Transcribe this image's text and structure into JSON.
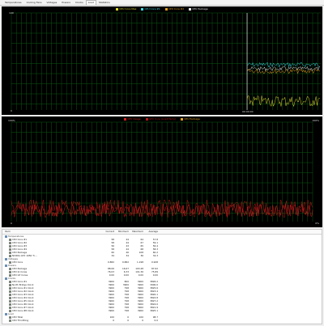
{
  "tabs": [
    "Temperatures",
    "Cooling Fans",
    "Voltages",
    "Powers",
    "Clocks",
    "Load",
    "Statistics"
  ],
  "active_tab": 5,
  "colors": {
    "yellow": "#d8d830",
    "cyan": "#38d8e0",
    "orange": "#e0a020",
    "white": "#e8e8e8",
    "red": "#d02020",
    "darkred": "#b01818",
    "grid": "#0b5a12"
  },
  "chart_top": {
    "legend": [
      {
        "label": "CPU Core Max",
        "color": "#d8d830"
      },
      {
        "label": "CPU Core #1",
        "color": "#38d8e0"
      },
      {
        "label": "CPU Core #2",
        "color": "#e0a020"
      },
      {
        "label": "CPU Package",
        "color": "#e8e8e8"
      }
    ],
    "y_top": "100",
    "y_bottom": "0",
    "x_label": "00:00:00"
  },
  "chart_bottom": {
    "legend": [
      {
        "label": "CPU Usage",
        "color": "#d02020"
      },
      {
        "label": "GPU Core (Load/Temp)",
        "color": "#b01818"
      },
      {
        "label": "CPU Package",
        "color": "#e0a020"
      }
    ],
    "y_top": "100%",
    "y_bottom": "0",
    "y_top_right": "100%",
    "y_bottom_right": "0%"
  },
  "table": {
    "headers": [
      "Item",
      "Current",
      "Minimum",
      "Maximum",
      "Average"
    ],
    "rows": [
      {
        "name": "Temperatures",
        "group": true,
        "cb": false,
        "vals": [
          "",
          "",
          "",
          ""
        ]
      },
      {
        "name": "CPU Core #1",
        "group": false,
        "cb": true,
        "vals": [
          "58",
          "44",
          "64",
          "57.8"
        ]
      },
      {
        "name": "CPU Core #2",
        "group": false,
        "cb": true,
        "vals": [
          "58",
          "44",
          "67",
          "59.1"
        ]
      },
      {
        "name": "CPU Core #3",
        "group": false,
        "cb": true,
        "vals": [
          "56",
          "43",
          "65",
          "56.4"
        ]
      },
      {
        "name": "CPU Core #4",
        "group": false,
        "cb": true,
        "vals": [
          "58",
          "44",
          "68",
          "58.3"
        ]
      },
      {
        "name": "CPU Package",
        "group": false,
        "cb": true,
        "vals": [
          "60",
          "46",
          "108",
          "60.2"
        ]
      },
      {
        "name": "NVIDIA GTX 1050 Ti ...",
        "group": false,
        "cb": true,
        "vals": [
          "34",
          "34",
          "36",
          "34.3"
        ]
      },
      {
        "name": "Voltages",
        "group": true,
        "cb": false,
        "vals": [
          "",
          "",
          "",
          ""
        ]
      },
      {
        "name": "CPU Core",
        "group": false,
        "cb": true,
        "vals": [
          "0.882",
          "0.882",
          "1.198",
          "0.928"
        ]
      },
      {
        "name": "Powers",
        "group": true,
        "cb": false,
        "vals": [
          "",
          "",
          "",
          ""
        ]
      },
      {
        "name": "CPU Package",
        "group": false,
        "cb": true,
        "vals": [
          "88.06",
          "16.67",
          "103.48",
          "87.62"
        ]
      },
      {
        "name": "CPU IA Cores",
        "group": false,
        "cb": true,
        "vals": [
          "76.03",
          "6.33",
          "101.36",
          "75.89"
        ]
      },
      {
        "name": "CPU GT Cores",
        "group": false,
        "cb": true,
        "vals": [
          "0.00",
          "0.00",
          "0.00",
          "0.00"
        ]
      },
      {
        "name": "Clocks",
        "group": true,
        "cb": false,
        "vals": [
          "",
          "",
          "",
          ""
        ]
      },
      {
        "name": "CPU Core #1",
        "group": false,
        "cb": true,
        "vals": [
          "3900",
          "800",
          "3900",
          "3826.2"
        ]
      },
      {
        "name": "North Bridge Clock",
        "group": false,
        "cb": true,
        "vals": [
          "3900",
          "3900",
          "3900",
          "3900.0"
        ]
      },
      {
        "name": "CPU Core #1 Clock",
        "group": false,
        "cb": true,
        "vals": [
          "3900",
          "798",
          "3900",
          "3825.6"
        ]
      },
      {
        "name": "CPU Core #2 Clock",
        "group": false,
        "cb": true,
        "vals": [
          "3900",
          "798",
          "3900",
          "3823.4"
        ]
      },
      {
        "name": "CPU Core #3 Clock",
        "group": false,
        "cb": true,
        "vals": [
          "3900",
          "798",
          "3900",
          "3820.1"
        ]
      },
      {
        "name": "CPU Core #4 Clock",
        "group": false,
        "cb": true,
        "vals": [
          "3900",
          "798",
          "3900",
          "3822.8"
        ]
      },
      {
        "name": "CPU Core #5 Clock",
        "group": false,
        "cb": true,
        "vals": [
          "3900",
          "798",
          "3900",
          "3827.2"
        ]
      },
      {
        "name": "CPU Core #6 Clock",
        "group": false,
        "cb": true,
        "vals": [
          "3900",
          "798",
          "3900",
          "3824.0"
        ]
      },
      {
        "name": "CPU Core #7 Clock",
        "group": false,
        "cb": true,
        "vals": [
          "3900",
          "798",
          "3900",
          "3821.9"
        ]
      },
      {
        "name": "CPU Core #8 Clock",
        "group": false,
        "cb": true,
        "vals": [
          "3900",
          "798",
          "3900",
          "3825.1"
        ]
      },
      {
        "name": "Load",
        "group": true,
        "cb": false,
        "vals": [
          "",
          "",
          "",
          ""
        ]
      },
      {
        "name": "CPU Total",
        "group": false,
        "cb": true,
        "vals": [
          "100",
          "0",
          "100",
          "98.7"
        ]
      },
      {
        "name": "CPU Throttling",
        "group": false,
        "cb": true,
        "vals": [
          "0",
          "0",
          "0",
          "0.0"
        ]
      }
    ]
  }
}
